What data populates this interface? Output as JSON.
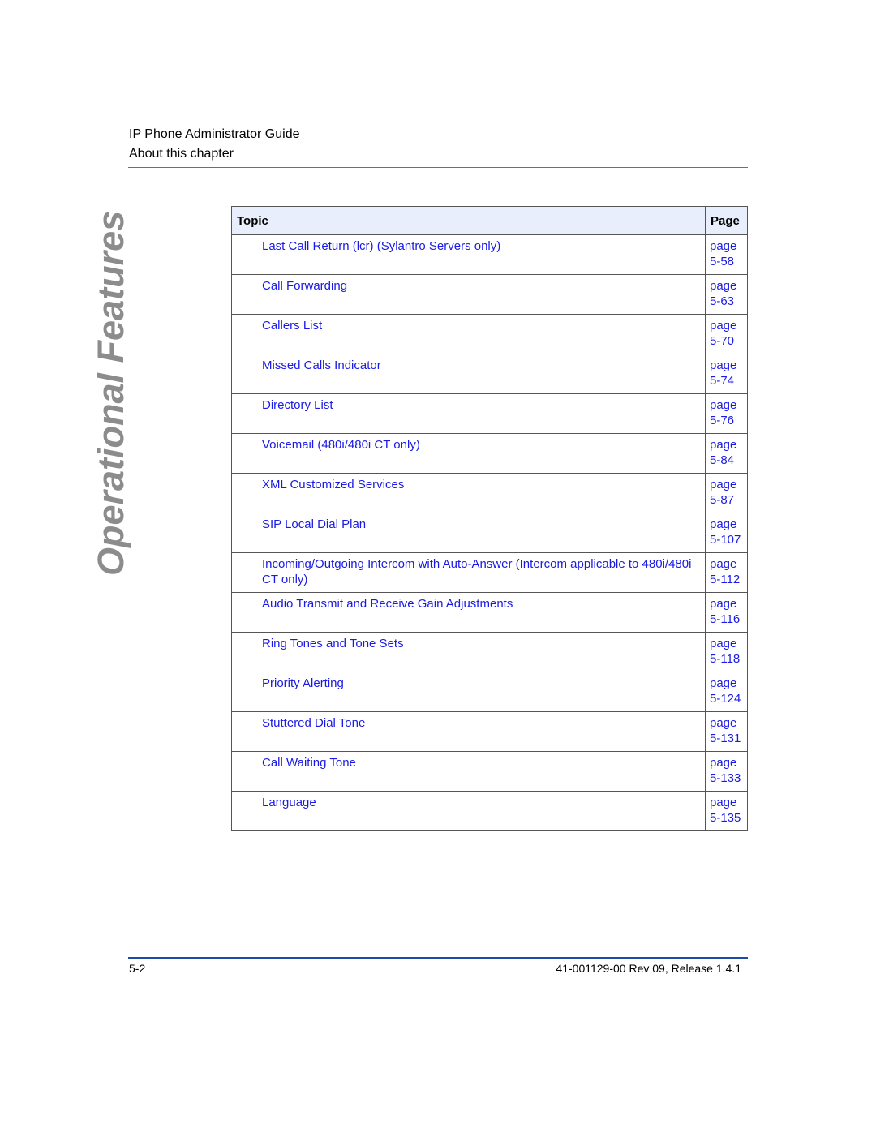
{
  "header": {
    "book_title": "IP Phone Administrator Guide",
    "section_title": "About this chapter"
  },
  "side_title": "Operational Features",
  "toc": {
    "columns": [
      "Topic",
      "Page"
    ],
    "rows": [
      {
        "topic": "Last Call Return (lcr) (Sylantro Servers only)",
        "page": "page 5-58"
      },
      {
        "topic": "Call Forwarding",
        "page": "page 5-63"
      },
      {
        "topic": "Callers List",
        "page": "page 5-70"
      },
      {
        "topic": "Missed Calls Indicator",
        "page": "page 5-74"
      },
      {
        "topic": "Directory List",
        "page": "page 5-76"
      },
      {
        "topic": "Voicemail (480i/480i CT only)",
        "page": "page 5-84"
      },
      {
        "topic": "XML Customized Services",
        "page": "page 5-87"
      },
      {
        "topic": "SIP Local Dial Plan",
        "page": "page 5-107"
      },
      {
        "topic": "Incoming/Outgoing Intercom with Auto-Answer (Intercom applicable to 480i/480i CT only)",
        "page": "page 5-112"
      },
      {
        "topic": "Audio Transmit and Receive Gain Adjustments",
        "page": "page 5-116"
      },
      {
        "topic": "Ring Tones and Tone Sets",
        "page": "page 5-118"
      },
      {
        "topic": "Priority Alerting",
        "page": "page 5-124"
      },
      {
        "topic": "Stuttered Dial Tone",
        "page": "page 5-131"
      },
      {
        "topic": "Call Waiting Tone",
        "page": "page 5-133"
      },
      {
        "topic": "Language",
        "page": "page 5-135"
      }
    ]
  },
  "footer": {
    "page_number": "5-2",
    "document_id": "41-001129-00 Rev 09, Release 1.4.1"
  },
  "colors": {
    "link": "#1a1ae6",
    "header_rule": "#4a6fc7",
    "footer_rule": "#1f4aa8",
    "table_header_bg": "#e8eefb",
    "side_title": "#8c8c8c"
  }
}
